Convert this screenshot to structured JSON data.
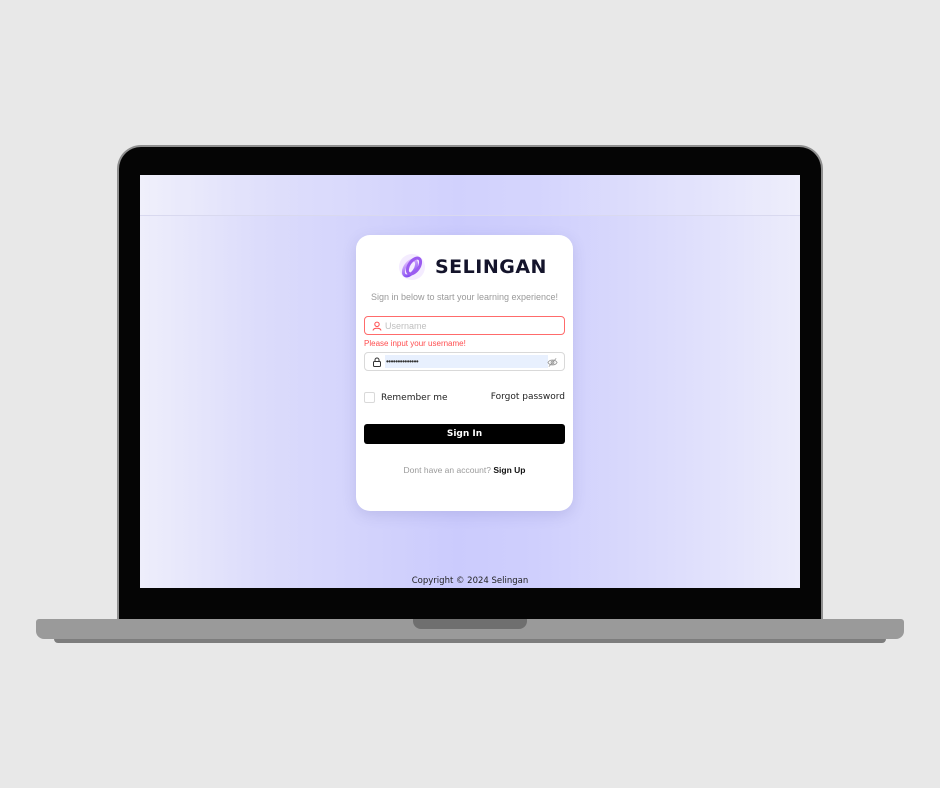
{
  "app": {
    "brand_name": "SELINGAN",
    "subtitle": "Sign in below to start your learning experience!"
  },
  "form": {
    "username_placeholder": "Username",
    "username_value": "",
    "username_error": "Please input your username!",
    "password_value": "••••••••••••••",
    "remember_label": "Remember me",
    "remember_checked": false,
    "forgot_label": "Forgot password",
    "signin_label": "Sign In",
    "signup_prompt": "Dont have an account?",
    "signup_label": "Sign Up"
  },
  "footer": {
    "copyright": "Copyright © 2024 Selingan"
  },
  "icons": {
    "logo": "selingan-logo-icon",
    "user": "user-icon",
    "lock": "lock-icon",
    "eye": "eye-off-icon"
  },
  "colors": {
    "accent": "#000000",
    "error": "#ff4d4f",
    "background_gradient": "#cbcbfd"
  }
}
